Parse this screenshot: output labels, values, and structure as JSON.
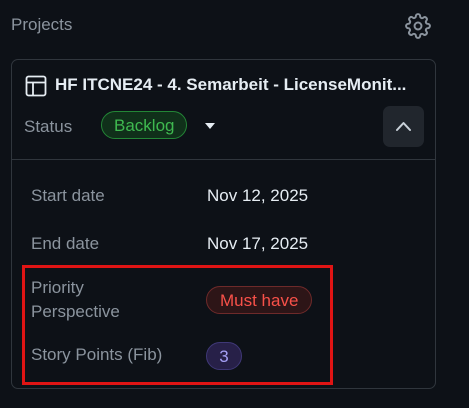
{
  "section": {
    "title": "Projects",
    "settings_icon": "gear-icon"
  },
  "project": {
    "icon": "table-icon",
    "title": "HF ITCNE24 - 4. Semarbeit - LicenseMonit...",
    "status_label": "Status",
    "status_value": "Backlog",
    "status_color": "#3fb950",
    "collapse_icon": "chevron-up-icon"
  },
  "fields": {
    "start_date": {
      "label": "Start date",
      "value": "Nov 12, 2025"
    },
    "end_date": {
      "label": "End date",
      "value": "Nov 17, 2025"
    },
    "priority": {
      "label_line1": "Priority",
      "label_line2": "Perspective",
      "value": "Must have",
      "color": "#f85149"
    },
    "story_points": {
      "label": "Story Points (Fib)",
      "value": "3",
      "color": "#a5a0f5"
    }
  },
  "highlight_color": "#e01414"
}
